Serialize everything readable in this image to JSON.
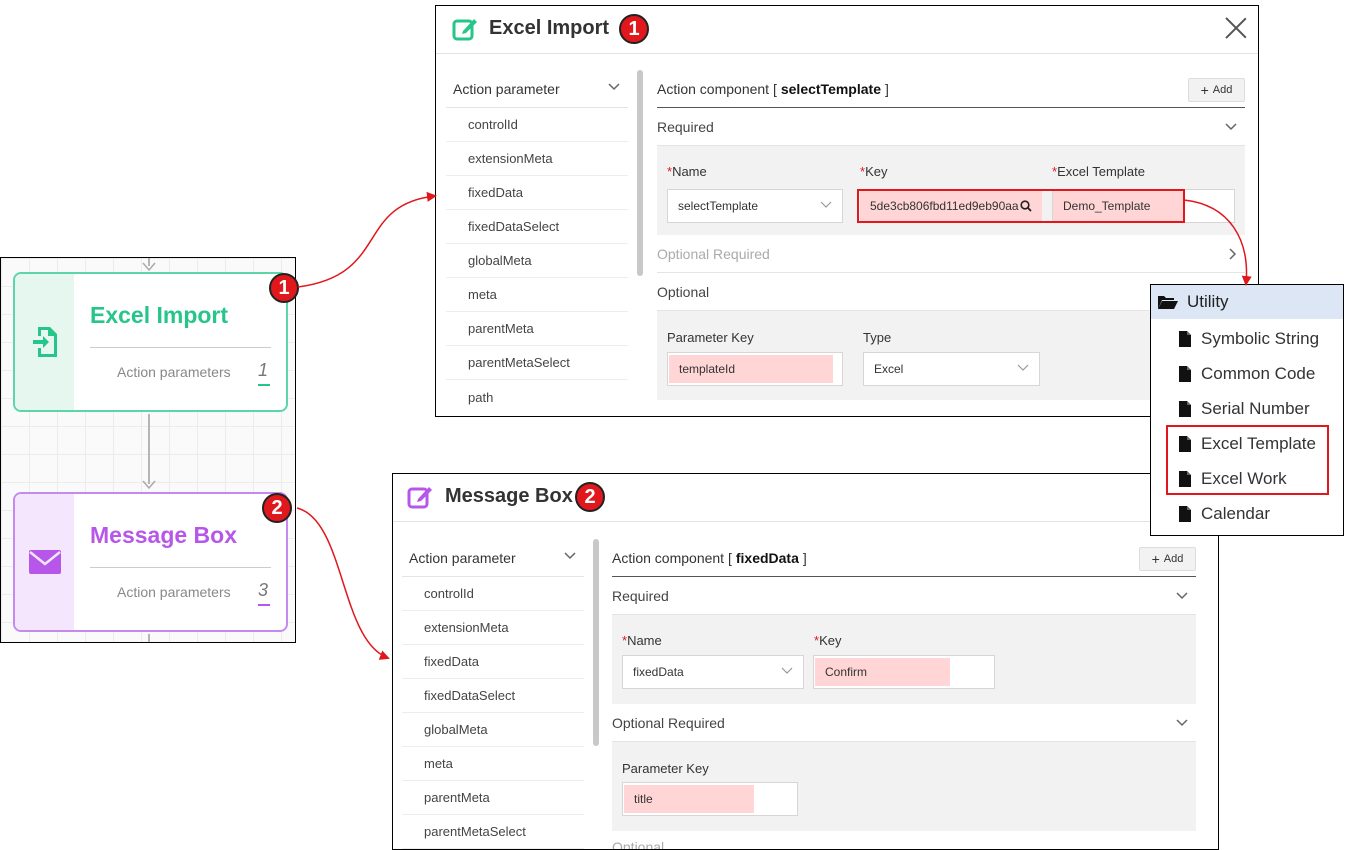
{
  "flow": {
    "nodes": [
      {
        "title": "Excel Import",
        "sub": "Action parameters",
        "count": "1",
        "badge": "1",
        "icon": "file-import-icon"
      },
      {
        "title": "Message Box",
        "sub": "Action parameters",
        "count": "3",
        "badge": "2",
        "icon": "envelope-icon"
      }
    ]
  },
  "dialog1": {
    "title": "Excel Import",
    "badge": "1",
    "side": {
      "header": "Action parameter",
      "items": [
        "controlId",
        "extensionMeta",
        "fixedData",
        "fixedDataSelect",
        "globalMeta",
        "meta",
        "parentMeta",
        "parentMetaSelect",
        "path"
      ]
    },
    "component_prefix": "Action component [",
    "component_name": "selectTemplate",
    "component_suffix": "]",
    "add_label": "Add",
    "required_label": "Required",
    "name_label": "Name",
    "name_value": "selectTemplate",
    "key_label": "Key",
    "key_value": "5de3cb806fbd11ed9eb90aa",
    "template_label": "Excel Template",
    "template_value": "Demo_Template",
    "optional_required_label": "Optional Required",
    "optional_label": "Optional",
    "param_key_label": "Parameter Key",
    "param_key_value": "templateId",
    "type_label": "Type",
    "type_value": "Excel"
  },
  "dialog2": {
    "title": "Message Box",
    "badge": "2",
    "side": {
      "header": "Action parameter",
      "items": [
        "controlId",
        "extensionMeta",
        "fixedData",
        "fixedDataSelect",
        "globalMeta",
        "meta",
        "parentMeta",
        "parentMetaSelect"
      ]
    },
    "component_prefix": "Action component [",
    "component_name": "fixedData",
    "component_suffix": "]",
    "add_label": "Add",
    "required_label": "Required",
    "name_label": "Name",
    "name_value": "fixedData",
    "key_label": "Key",
    "key_value": "Confirm",
    "optional_required_label": "Optional Required",
    "param_key_label": "Parameter Key",
    "param_key_value": "title",
    "optional_label": "Optional"
  },
  "tree": {
    "root": "Utility",
    "items": [
      "Symbolic String",
      "Common Code",
      "Serial Number",
      "Excel Template",
      "Excel Work",
      "Calendar"
    ]
  },
  "colors": {
    "green": "#26c58a",
    "purple": "#b757ea",
    "red": "#e0171c",
    "highlight": "#ffd5d5"
  }
}
